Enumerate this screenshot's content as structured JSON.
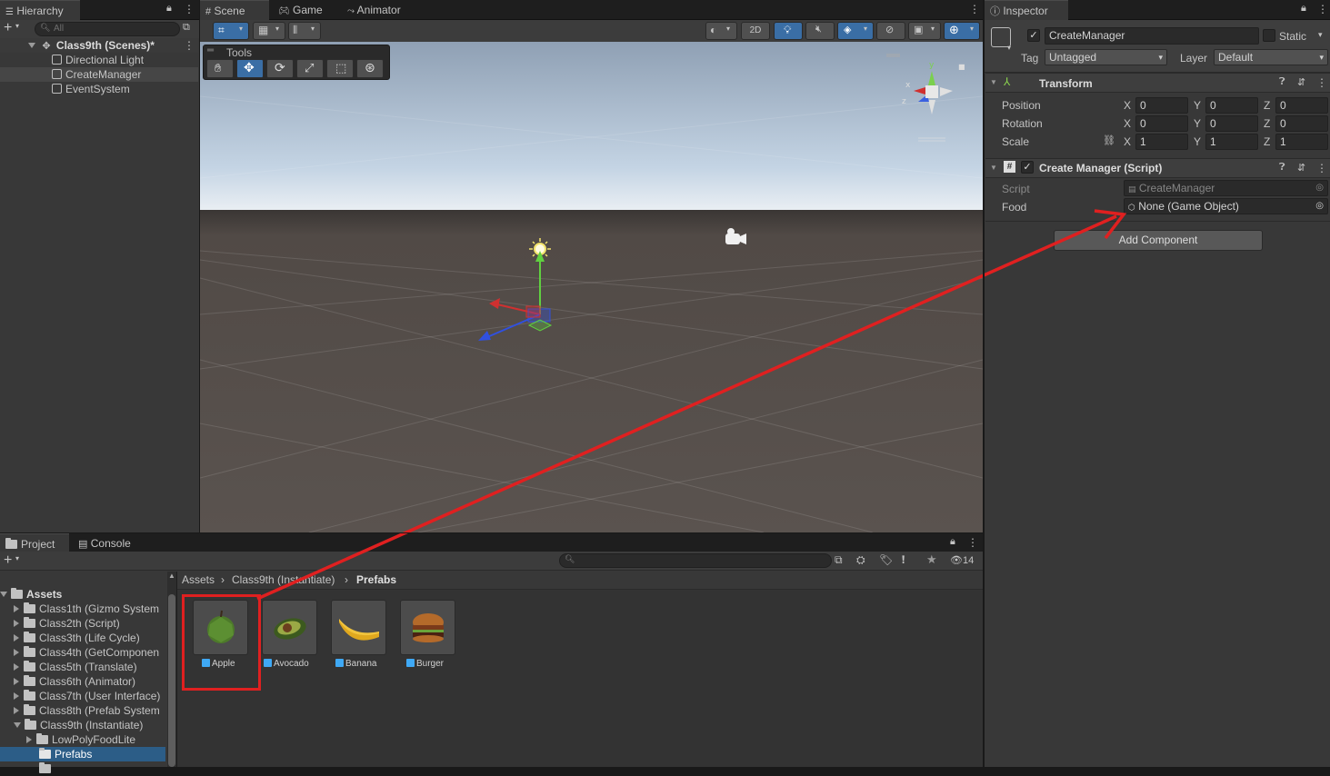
{
  "hierarchy": {
    "tab": "Hierarchy",
    "search_placeholder": "All",
    "scene": "Class9th (Scenes)*",
    "items": [
      "Directional Light",
      "CreateManager",
      "EventSystem"
    ]
  },
  "scene_view": {
    "tabs": [
      "Scene",
      "Game",
      "Animator"
    ],
    "toolbar_2d": "2D",
    "tools_label": "Tools",
    "gizmo_axes": {
      "x": "x",
      "y": "y",
      "z": "z"
    }
  },
  "inspector": {
    "tab": "Inspector",
    "object_name": "CreateManager",
    "static_label": "Static",
    "tag_label": "Tag",
    "tag_value": "Untagged",
    "layer_label": "Layer",
    "layer_value": "Default",
    "transform": {
      "title": "Transform",
      "rows": [
        {
          "label": "Position",
          "x": "0",
          "y": "0",
          "z": "0"
        },
        {
          "label": "Rotation",
          "x": "0",
          "y": "0",
          "z": "0"
        },
        {
          "label": "Scale",
          "x": "1",
          "y": "1",
          "z": "1"
        }
      ],
      "axis": {
        "x": "X",
        "y": "Y",
        "z": "Z"
      }
    },
    "script_component": {
      "title": "Create Manager (Script)",
      "script_label": "Script",
      "script_value": "CreateManager",
      "food_label": "Food",
      "food_value": "None (Game Object)"
    },
    "add_component": "Add Component"
  },
  "project": {
    "tabs": [
      "Project",
      "Console"
    ],
    "hidden_count": "14",
    "breadcrumb": [
      "Assets",
      "Class9th (Instantiate)",
      "Prefabs"
    ],
    "tree_root": "Assets",
    "tree": [
      "Class1th (Gizmo System",
      "Class2th (Script)",
      "Class3th (Life Cycle)",
      "Class4th (GetComponen",
      "Class5th (Translate)",
      "Class6th (Animator)",
      "Class7th (User Interface)",
      "Class8th (Prefab System",
      "Class9th (Instantiate)"
    ],
    "subtree": [
      "LowPolyFoodLite",
      "Prefabs"
    ],
    "assets": [
      "Apple",
      "Avocado",
      "Banana",
      "Burger"
    ]
  },
  "colors": {
    "highlight_red": "#e02020",
    "selection_blue": "#2c5d87",
    "panel": "#383838"
  }
}
